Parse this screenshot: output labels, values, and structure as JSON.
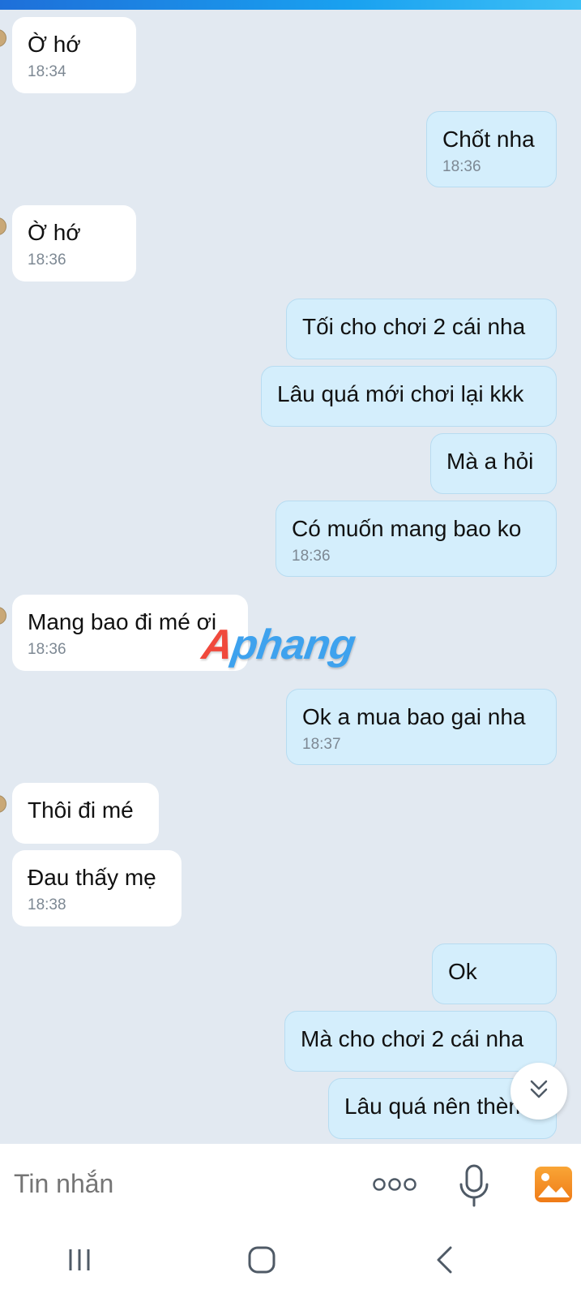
{
  "messages": [
    {
      "side": "in",
      "text": "Ờ hớ",
      "time": "18:34"
    },
    {
      "side": "out",
      "text": "Chốt nha",
      "time": "18:36"
    },
    {
      "side": "in",
      "text": "Ờ hớ",
      "time": "18:36"
    },
    {
      "side": "out",
      "text": "Tối cho chơi 2 cái nha"
    },
    {
      "side": "out",
      "text": "Lâu quá mới chơi lại kkk"
    },
    {
      "side": "out",
      "text": "Mà a hỏi"
    },
    {
      "side": "out",
      "text": "Có muốn mang bao ko",
      "time": "18:36"
    },
    {
      "side": "in",
      "text": "Mang bao đi mé ơi",
      "time": "18:36"
    },
    {
      "side": "out",
      "text": "Ok a mua bao gai nha",
      "time": "18:37"
    },
    {
      "side": "in",
      "text": "Thôi đi mé"
    },
    {
      "side": "in",
      "text": "Đau thấy mẹ",
      "time": "18:38"
    },
    {
      "side": "out",
      "text": "Ok"
    },
    {
      "side": "out",
      "text": "Mà cho chơi 2 cái nha"
    },
    {
      "side": "out",
      "text": "Lâu quá nên thèm"
    }
  ],
  "watermark": {
    "part1": "A",
    "part2": "phang"
  },
  "input": {
    "placeholder": "Tin nhắn"
  },
  "icons": {
    "more": "more-options-icon",
    "mic": "microphone-icon",
    "photo": "photo-gallery-icon",
    "scroll": "scroll-down-icon",
    "recents": "recent-apps-icon",
    "home": "home-icon",
    "back": "back-icon"
  },
  "colors": {
    "background": "#e2e9f1",
    "outgoing": "#d4eefc",
    "incoming": "#ffffff",
    "accent": "#f28a1e"
  }
}
